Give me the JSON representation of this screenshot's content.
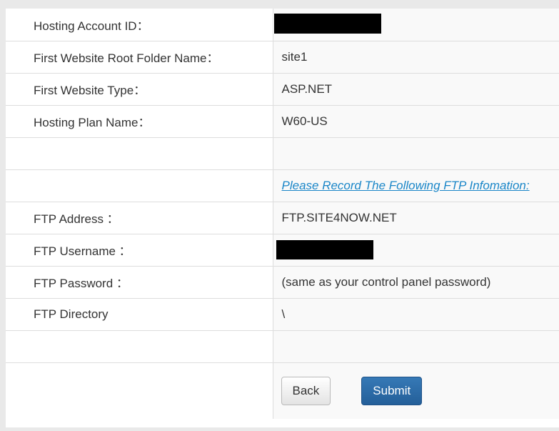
{
  "rows": [
    {
      "label": "Hosting Account ID：",
      "value": "",
      "redacted": true
    },
    {
      "label": "First Website Root Folder Name：",
      "value": "site1"
    },
    {
      "label": "First Website Type：",
      "value": "ASP.NET"
    },
    {
      "label": "Hosting Plan Name：",
      "value": "W60-US"
    },
    {
      "label": "",
      "value": ""
    },
    {
      "label": "",
      "link": "Please Record The Following FTP Infomation:"
    },
    {
      "label": "FTP Address ：",
      "value": "FTP.SITE4NOW.NET"
    },
    {
      "label": "FTP Username ：",
      "value": "",
      "redacted": true
    },
    {
      "label": "FTP Password ：",
      "value": "(same as your control panel password)"
    },
    {
      "label": "FTP Directory",
      "value": "\\"
    },
    {
      "label": "",
      "value": ""
    }
  ],
  "actions": {
    "back_label": "Back",
    "submit_label": "Submit"
  },
  "colors": {
    "link": "#1a86c8",
    "submit_button": "#2b6aa6",
    "value_column_bg": "#f9f9f9",
    "redaction": "#000000"
  }
}
